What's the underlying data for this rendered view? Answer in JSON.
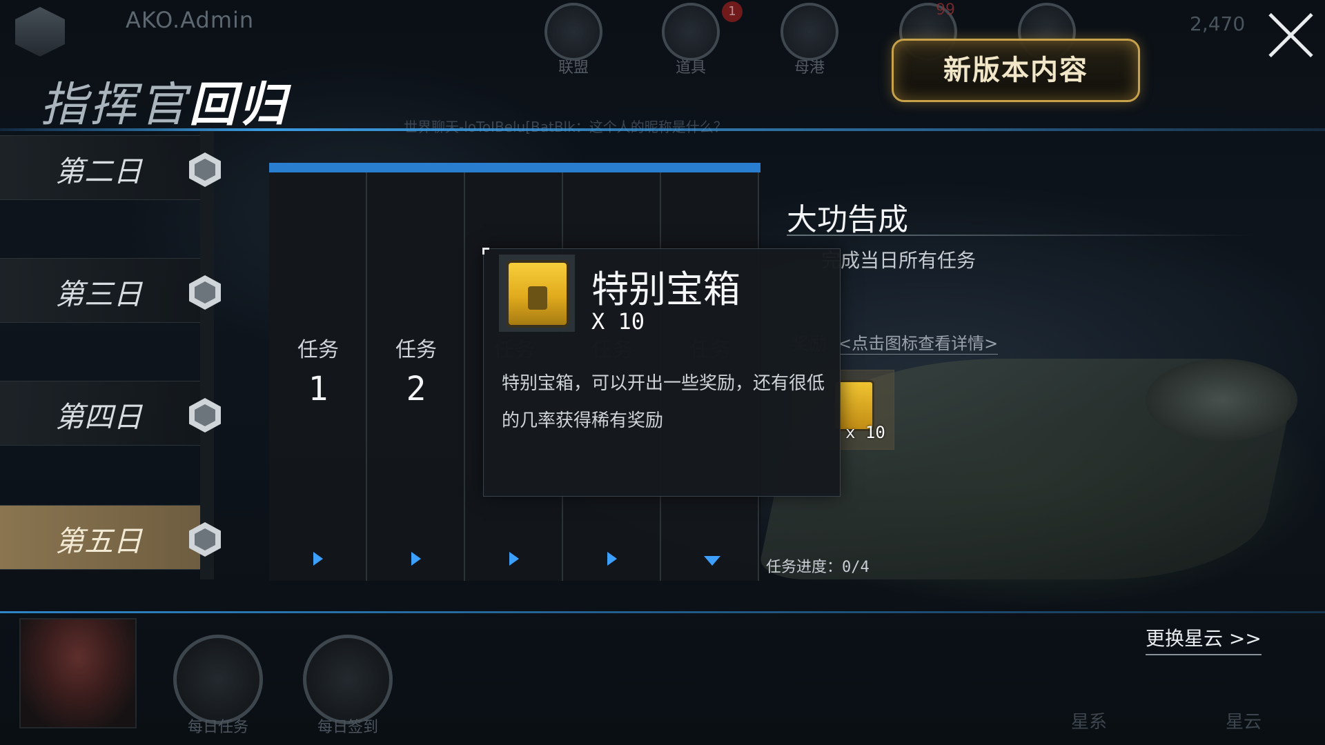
{
  "header": {
    "username": "AKO.Admin",
    "currency": "2,470",
    "notification_badge": "1",
    "mail_badge": "99",
    "nav": [
      {
        "label": "联盟",
        "icon": "globe-icon"
      },
      {
        "label": "道具",
        "icon": "chest-icon"
      },
      {
        "label": "母港",
        "icon": "helmet-icon"
      }
    ],
    "new_version_label": "新版本内容"
  },
  "title": {
    "prefix": "指挥官",
    "emphasis": "回归"
  },
  "chat_ticker": "世界聊天-loToIBelu[BatBlk：这个人的昵称是什么？",
  "days": [
    {
      "label": "第二日",
      "active": false
    },
    {
      "label": "第三日",
      "active": false
    },
    {
      "label": "第四日",
      "active": false
    },
    {
      "label": "第五日",
      "active": true
    }
  ],
  "tasks": [
    {
      "label": "任务",
      "number": "1"
    },
    {
      "label": "任务",
      "number": "2"
    },
    {
      "label": "任务",
      "number": ""
    },
    {
      "label": "任务",
      "number": ""
    },
    {
      "label": "任务",
      "number": ""
    }
  ],
  "mission": {
    "title": "大功告成",
    "description": "完成当日所有任务",
    "reward_label": "奖励",
    "reward_hint": "<点击图标查看详情>",
    "reward_qty": "x 10",
    "progress_label": "任务进度：",
    "progress_value": "0/4"
  },
  "tooltip": {
    "name": "特别宝箱",
    "qty": "X 10",
    "description": "特别宝箱，可以开出一些奖励，还有很低的几率获得稀有奖励"
  },
  "bottom": {
    "daily_tasks": "每日任务",
    "daily_signin": "每日签到",
    "change_nebula": "更换星云 >>",
    "galaxy": "星系",
    "nebula": "星云"
  },
  "colors": {
    "accent_blue": "#2a7ed0",
    "gold": "#c9a24c",
    "active_day": "#8a7550"
  }
}
